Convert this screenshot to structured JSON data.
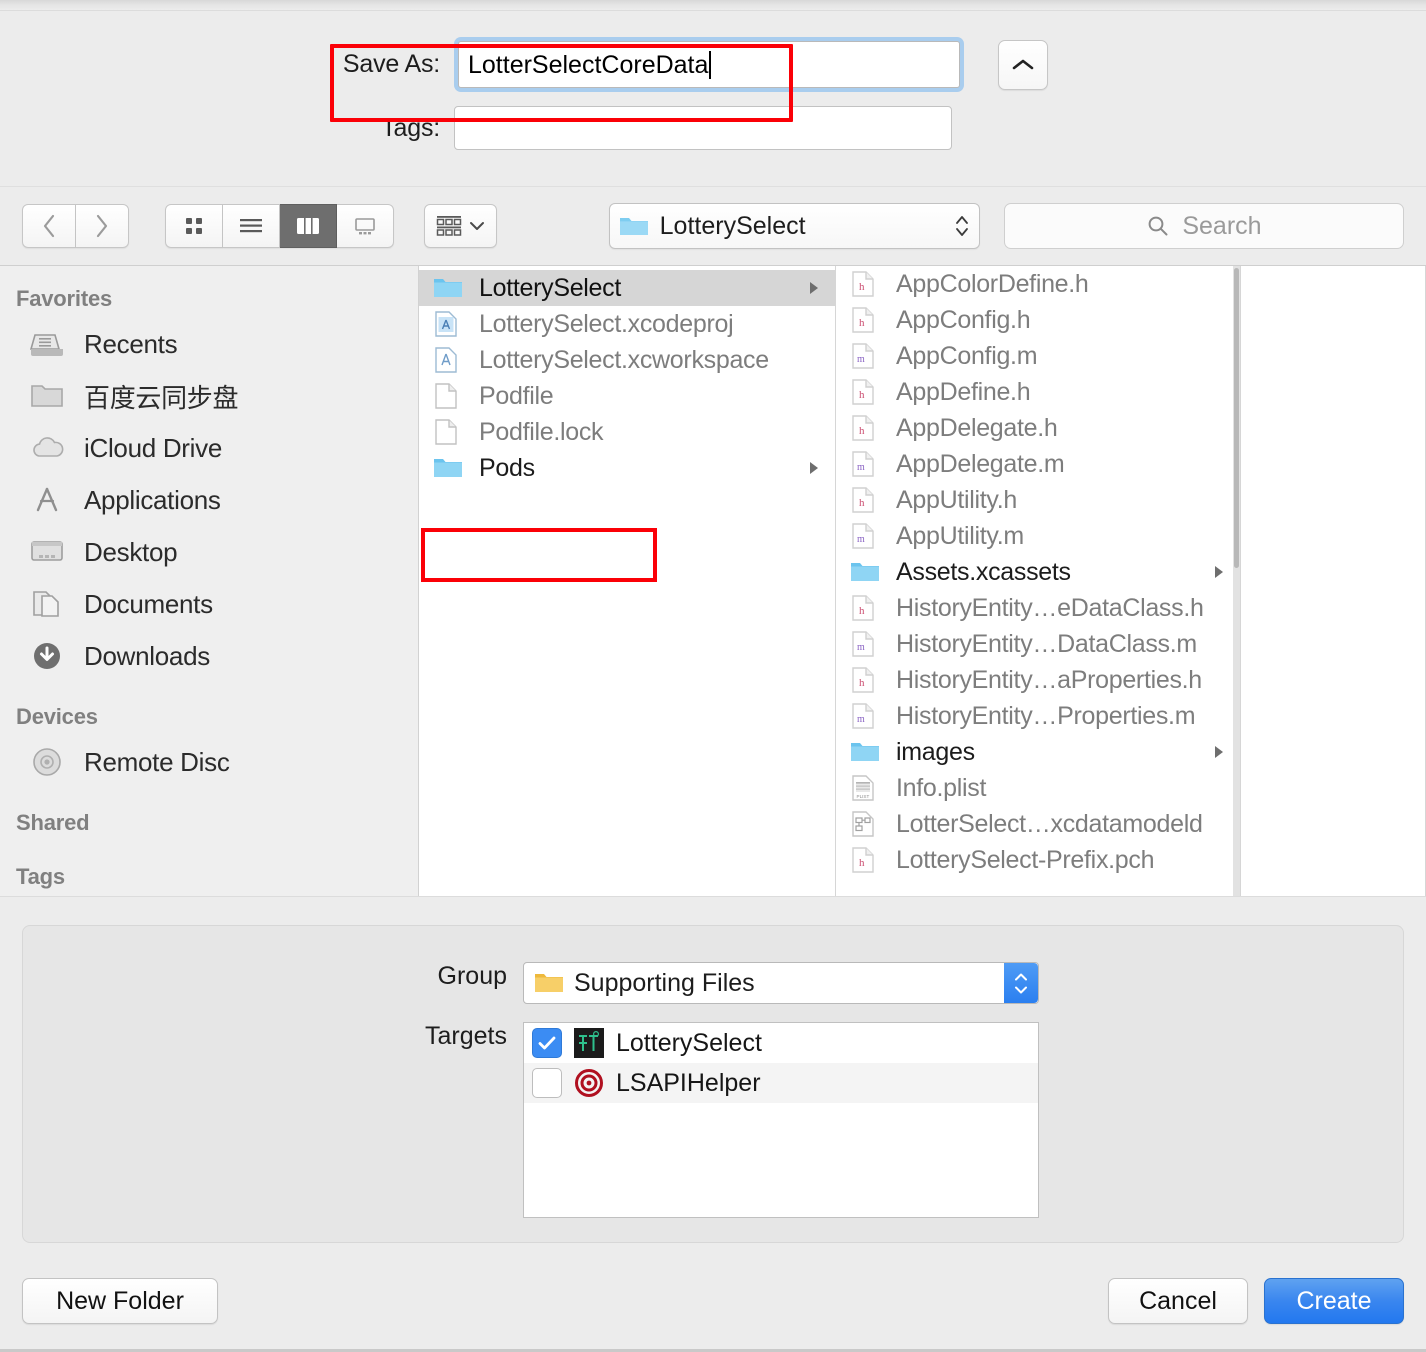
{
  "dialog": {
    "save_as_label": "Save As:",
    "save_as_value": "LotterSelectCoreData",
    "tags_label": "Tags:",
    "tags_value": "",
    "disclosure_icon": "chevron-up-icon"
  },
  "toolbar": {
    "back_icon": "chevron-left-icon",
    "forward_icon": "chevron-right-icon",
    "view_icon_grid": "icon-view-icon",
    "view_list": "list-view-icon",
    "view_column": "column-view-icon",
    "arrange_icon": "arrange-grid-icon",
    "arrange_chevron": "chevron-down-icon",
    "path_label": "LotterySelect",
    "path_icon": "folder-icon",
    "path_stepper_icon": "updown-chevron-icon",
    "search_icon": "search-icon",
    "search_placeholder": "Search",
    "search_value": ""
  },
  "sidebar": {
    "sections": [
      {
        "header": "Favorites",
        "items": [
          {
            "label": "Recents",
            "icon": "recents-icon"
          },
          {
            "label": "百度云同步盘",
            "icon": "folder-gray-icon"
          },
          {
            "label": "iCloud Drive",
            "icon": "cloud-icon"
          },
          {
            "label": "Applications",
            "icon": "applications-icon"
          },
          {
            "label": "Desktop",
            "icon": "desktop-icon"
          },
          {
            "label": "Documents",
            "icon": "documents-icon"
          },
          {
            "label": "Downloads",
            "icon": "downloads-icon"
          }
        ]
      },
      {
        "header": "Devices",
        "items": [
          {
            "label": "Remote Disc",
            "icon": "disc-icon"
          }
        ]
      },
      {
        "header": "Shared",
        "items": []
      },
      {
        "header": "Tags",
        "items": []
      }
    ]
  },
  "browser": {
    "column1": [
      {
        "name": "LotterySelect",
        "icon": "folder-blue-icon",
        "selected": true,
        "has_children": true
      },
      {
        "name": "LotterySelect.xcodeproj",
        "icon": "xcodeproj-icon",
        "selected": false,
        "has_children": false
      },
      {
        "name": "LotterySelect.xcworkspace",
        "icon": "xcworkspace-icon",
        "selected": false,
        "has_children": false
      },
      {
        "name": "Podfile",
        "icon": "document-icon",
        "selected": false,
        "has_children": false
      },
      {
        "name": "Podfile.lock",
        "icon": "document-icon",
        "selected": false,
        "has_children": false
      },
      {
        "name": "Pods",
        "icon": "folder-blue-icon",
        "selected": false,
        "has_children": true
      }
    ],
    "column2": [
      {
        "name": "AppColorDefine.h",
        "icon": "header-file-icon",
        "has_children": false
      },
      {
        "name": "AppConfig.h",
        "icon": "header-file-icon",
        "has_children": false
      },
      {
        "name": "AppConfig.m",
        "icon": "source-file-icon",
        "has_children": false
      },
      {
        "name": "AppDefine.h",
        "icon": "header-file-icon",
        "has_children": false
      },
      {
        "name": "AppDelegate.h",
        "icon": "header-file-icon",
        "has_children": false
      },
      {
        "name": "AppDelegate.m",
        "icon": "source-file-icon",
        "has_children": false
      },
      {
        "name": "AppUtility.h",
        "icon": "header-file-icon",
        "has_children": false
      },
      {
        "name": "AppUtility.m",
        "icon": "source-file-icon",
        "has_children": false
      },
      {
        "name": "Assets.xcassets",
        "icon": "folder-blue-icon",
        "has_children": true
      },
      {
        "name": "HistoryEntity…eDataClass.h",
        "icon": "header-file-icon",
        "has_children": false
      },
      {
        "name": "HistoryEntity…DataClass.m",
        "icon": "source-file-icon",
        "has_children": false
      },
      {
        "name": "HistoryEntity…aProperties.h",
        "icon": "header-file-icon",
        "has_children": false
      },
      {
        "name": "HistoryEntity…Properties.m",
        "icon": "source-file-icon",
        "has_children": false
      },
      {
        "name": "images",
        "icon": "folder-blue-icon",
        "has_children": true
      },
      {
        "name": "Info.plist",
        "icon": "plist-icon",
        "has_children": false
      },
      {
        "name": "LotterSelect…xcdatamodeld",
        "icon": "xcdatamodeld-icon",
        "has_children": false
      },
      {
        "name": "LotterySelect-Prefix.pch",
        "icon": "header-file-icon",
        "has_children": false
      }
    ]
  },
  "accessory": {
    "group_label": "Group",
    "group_value": "Supporting Files",
    "group_icon": "folder-yellow-icon",
    "targets_label": "Targets",
    "targets": [
      {
        "name": "LotterySelect",
        "checked": true,
        "icon": "app-target-icon"
      },
      {
        "name": "LSAPIHelper",
        "checked": false,
        "icon": "bullseye-target-icon"
      }
    ]
  },
  "footer": {
    "new_folder_label": "New Folder",
    "cancel_label": "Cancel",
    "create_label": "Create"
  },
  "colors": {
    "accent_blue": "#3a86ef",
    "annotation_red": "#fb0007",
    "focus_ring": "#a9cdee",
    "folder_blue": "#6fc6ef",
    "folder_yellow": "#f5c council"
  }
}
